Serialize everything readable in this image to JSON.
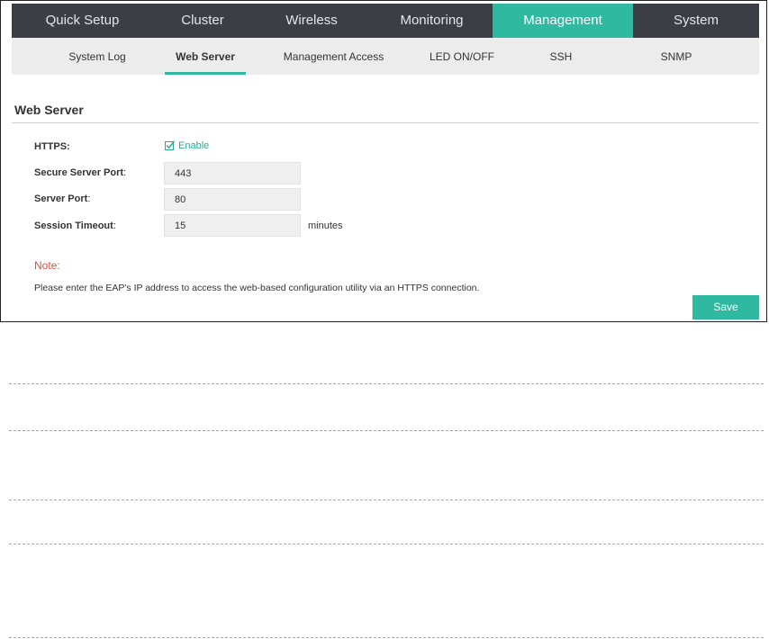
{
  "top_nav": {
    "tabs": [
      {
        "label": "Quick Setup",
        "active": false
      },
      {
        "label": "Cluster",
        "active": false
      },
      {
        "label": "Wireless",
        "active": false
      },
      {
        "label": "Monitoring",
        "active": false
      },
      {
        "label": "Management",
        "active": true
      },
      {
        "label": "System",
        "active": false
      }
    ]
  },
  "sub_nav": {
    "items": [
      {
        "label": "System Log",
        "active": false
      },
      {
        "label": "Web Server",
        "active": true
      },
      {
        "label": "Management Access",
        "active": false
      },
      {
        "label": "LED ON/OFF",
        "active": false
      },
      {
        "label": "SSH",
        "active": false
      },
      {
        "label": "SNMP",
        "active": false
      }
    ]
  },
  "section": {
    "title": "Web Server"
  },
  "form": {
    "https": {
      "label": "HTTPS:",
      "checkbox_label": "Enable",
      "checked": true
    },
    "secure_port": {
      "label": "Secure Server Port",
      "colon": ":",
      "value": "443"
    },
    "server_port": {
      "label": "Server Port",
      "colon": ":",
      "value": "80"
    },
    "session_timeout": {
      "label": "Session Timeout",
      "colon": ":",
      "value": "15",
      "unit": "minutes"
    }
  },
  "note": {
    "title": "Note:",
    "text": "Please enter the EAP's IP address to access the web-based configuration utility via an HTTPS connection."
  },
  "actions": {
    "save_label": "Save"
  },
  "colors": {
    "accent": "#2fb9a0",
    "nav_bg": "#3b3e45",
    "note": "#e74c3c"
  }
}
